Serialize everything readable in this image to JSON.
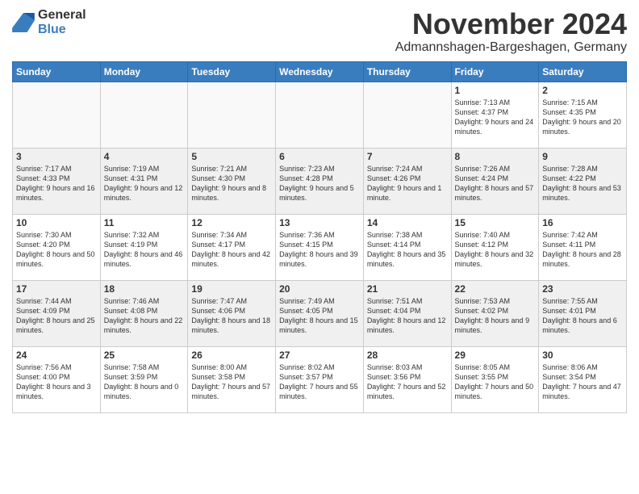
{
  "header": {
    "logo": {
      "general": "General",
      "blue": "Blue"
    },
    "month": "November 2024",
    "location": "Admannshagen-Bargeshagen, Germany"
  },
  "weekdays": [
    "Sunday",
    "Monday",
    "Tuesday",
    "Wednesday",
    "Thursday",
    "Friday",
    "Saturday"
  ],
  "weeks": [
    [
      {
        "day": "",
        "sunrise": "",
        "sunset": "",
        "daylight": "",
        "empty": true
      },
      {
        "day": "",
        "sunrise": "",
        "sunset": "",
        "daylight": "",
        "empty": true
      },
      {
        "day": "",
        "sunrise": "",
        "sunset": "",
        "daylight": "",
        "empty": true
      },
      {
        "day": "",
        "sunrise": "",
        "sunset": "",
        "daylight": "",
        "empty": true
      },
      {
        "day": "",
        "sunrise": "",
        "sunset": "",
        "daylight": "",
        "empty": true
      },
      {
        "day": "1",
        "sunrise": "Sunrise: 7:13 AM",
        "sunset": "Sunset: 4:37 PM",
        "daylight": "Daylight: 9 hours and 24 minutes."
      },
      {
        "day": "2",
        "sunrise": "Sunrise: 7:15 AM",
        "sunset": "Sunset: 4:35 PM",
        "daylight": "Daylight: 9 hours and 20 minutes."
      }
    ],
    [
      {
        "day": "3",
        "sunrise": "Sunrise: 7:17 AM",
        "sunset": "Sunset: 4:33 PM",
        "daylight": "Daylight: 9 hours and 16 minutes."
      },
      {
        "day": "4",
        "sunrise": "Sunrise: 7:19 AM",
        "sunset": "Sunset: 4:31 PM",
        "daylight": "Daylight: 9 hours and 12 minutes."
      },
      {
        "day": "5",
        "sunrise": "Sunrise: 7:21 AM",
        "sunset": "Sunset: 4:30 PM",
        "daylight": "Daylight: 9 hours and 8 minutes."
      },
      {
        "day": "6",
        "sunrise": "Sunrise: 7:23 AM",
        "sunset": "Sunset: 4:28 PM",
        "daylight": "Daylight: 9 hours and 5 minutes."
      },
      {
        "day": "7",
        "sunrise": "Sunrise: 7:24 AM",
        "sunset": "Sunset: 4:26 PM",
        "daylight": "Daylight: 9 hours and 1 minute."
      },
      {
        "day": "8",
        "sunrise": "Sunrise: 7:26 AM",
        "sunset": "Sunset: 4:24 PM",
        "daylight": "Daylight: 8 hours and 57 minutes."
      },
      {
        "day": "9",
        "sunrise": "Sunrise: 7:28 AM",
        "sunset": "Sunset: 4:22 PM",
        "daylight": "Daylight: 8 hours and 53 minutes."
      }
    ],
    [
      {
        "day": "10",
        "sunrise": "Sunrise: 7:30 AM",
        "sunset": "Sunset: 4:20 PM",
        "daylight": "Daylight: 8 hours and 50 minutes."
      },
      {
        "day": "11",
        "sunrise": "Sunrise: 7:32 AM",
        "sunset": "Sunset: 4:19 PM",
        "daylight": "Daylight: 8 hours and 46 minutes."
      },
      {
        "day": "12",
        "sunrise": "Sunrise: 7:34 AM",
        "sunset": "Sunset: 4:17 PM",
        "daylight": "Daylight: 8 hours and 42 minutes."
      },
      {
        "day": "13",
        "sunrise": "Sunrise: 7:36 AM",
        "sunset": "Sunset: 4:15 PM",
        "daylight": "Daylight: 8 hours and 39 minutes."
      },
      {
        "day": "14",
        "sunrise": "Sunrise: 7:38 AM",
        "sunset": "Sunset: 4:14 PM",
        "daylight": "Daylight: 8 hours and 35 minutes."
      },
      {
        "day": "15",
        "sunrise": "Sunrise: 7:40 AM",
        "sunset": "Sunset: 4:12 PM",
        "daylight": "Daylight: 8 hours and 32 minutes."
      },
      {
        "day": "16",
        "sunrise": "Sunrise: 7:42 AM",
        "sunset": "Sunset: 4:11 PM",
        "daylight": "Daylight: 8 hours and 28 minutes."
      }
    ],
    [
      {
        "day": "17",
        "sunrise": "Sunrise: 7:44 AM",
        "sunset": "Sunset: 4:09 PM",
        "daylight": "Daylight: 8 hours and 25 minutes."
      },
      {
        "day": "18",
        "sunrise": "Sunrise: 7:46 AM",
        "sunset": "Sunset: 4:08 PM",
        "daylight": "Daylight: 8 hours and 22 minutes."
      },
      {
        "day": "19",
        "sunrise": "Sunrise: 7:47 AM",
        "sunset": "Sunset: 4:06 PM",
        "daylight": "Daylight: 8 hours and 18 minutes."
      },
      {
        "day": "20",
        "sunrise": "Sunrise: 7:49 AM",
        "sunset": "Sunset: 4:05 PM",
        "daylight": "Daylight: 8 hours and 15 minutes."
      },
      {
        "day": "21",
        "sunrise": "Sunrise: 7:51 AM",
        "sunset": "Sunset: 4:04 PM",
        "daylight": "Daylight: 8 hours and 12 minutes."
      },
      {
        "day": "22",
        "sunrise": "Sunrise: 7:53 AM",
        "sunset": "Sunset: 4:02 PM",
        "daylight": "Daylight: 8 hours and 9 minutes."
      },
      {
        "day": "23",
        "sunrise": "Sunrise: 7:55 AM",
        "sunset": "Sunset: 4:01 PM",
        "daylight": "Daylight: 8 hours and 6 minutes."
      }
    ],
    [
      {
        "day": "24",
        "sunrise": "Sunrise: 7:56 AM",
        "sunset": "Sunset: 4:00 PM",
        "daylight": "Daylight: 8 hours and 3 minutes."
      },
      {
        "day": "25",
        "sunrise": "Sunrise: 7:58 AM",
        "sunset": "Sunset: 3:59 PM",
        "daylight": "Daylight: 8 hours and 0 minutes."
      },
      {
        "day": "26",
        "sunrise": "Sunrise: 8:00 AM",
        "sunset": "Sunset: 3:58 PM",
        "daylight": "Daylight: 7 hours and 57 minutes."
      },
      {
        "day": "27",
        "sunrise": "Sunrise: 8:02 AM",
        "sunset": "Sunset: 3:57 PM",
        "daylight": "Daylight: 7 hours and 55 minutes."
      },
      {
        "day": "28",
        "sunrise": "Sunrise: 8:03 AM",
        "sunset": "Sunset: 3:56 PM",
        "daylight": "Daylight: 7 hours and 52 minutes."
      },
      {
        "day": "29",
        "sunrise": "Sunrise: 8:05 AM",
        "sunset": "Sunset: 3:55 PM",
        "daylight": "Daylight: 7 hours and 50 minutes."
      },
      {
        "day": "30",
        "sunrise": "Sunrise: 8:06 AM",
        "sunset": "Sunset: 3:54 PM",
        "daylight": "Daylight: 7 hours and 47 minutes."
      }
    ]
  ]
}
